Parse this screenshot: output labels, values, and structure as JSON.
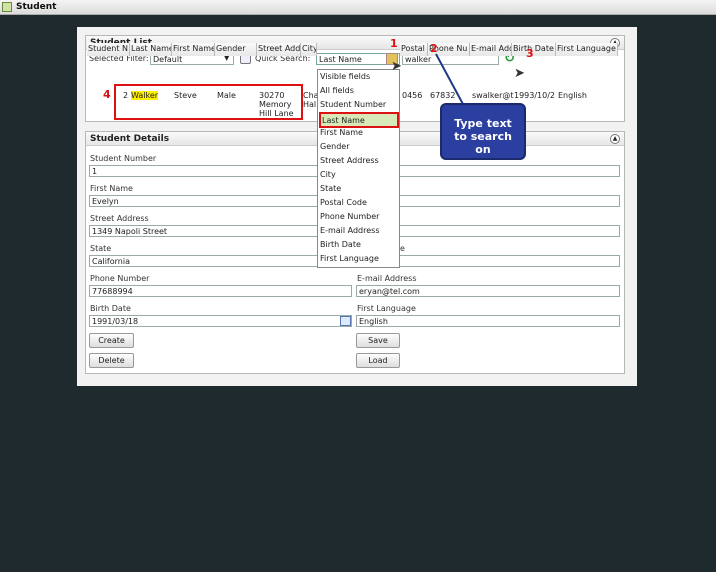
{
  "window": {
    "title": "Student"
  },
  "student_list": {
    "title": "Student List",
    "selected_filter_label": "Selected Filter:",
    "selected_filter_value": "Default",
    "quick_search_label": "Quick Search:",
    "quick_search_field": "Last Name",
    "search_value": "walker",
    "columns": [
      "Student N",
      "Last Name",
      "First Name",
      "Gender",
      "Street Addr",
      "City",
      "Postal Code",
      "Phone Nu",
      "E-mail Add",
      "Birth Date",
      "First Language"
    ],
    "row": {
      "num": "2",
      "last": "Walker",
      "first": "Steve",
      "gender": "Male",
      "street1": "30270",
      "street2": "Memory",
      "street3": "Hill Lane",
      "city": "Cha",
      "city2": "Hal",
      "postal": "0456",
      "phone": "67832",
      "email": "swalker@t",
      "birth": "1993/10/2",
      "lang": "English"
    }
  },
  "dropdown": {
    "items": [
      "Visible fields",
      "All fields",
      "Student Number",
      "Last Name",
      "First Name",
      "Gender",
      "Street Address",
      "City",
      "State",
      "Postal Code",
      "Phone Number",
      "E-mail Address",
      "Birth Date",
      "First Language"
    ]
  },
  "annotations": {
    "n1": "1",
    "n2": "2",
    "n3": "3",
    "n4": "4",
    "callout": "Type text to search on"
  },
  "student_details": {
    "title": "Student Details",
    "student_number_label": "Student Number",
    "student_number": "1",
    "first_name_label": "First Name",
    "first_name": "Evelyn",
    "street_label": "Street Address",
    "street": "1349 Napoli Street",
    "state_label": "State",
    "state": "California",
    "phone_label": "Phone Number",
    "phone": "77688994",
    "email_label": "E-mail Address",
    "email": "eryan@tel.com",
    "birth_label": "Birth Date",
    "birth": "1991/03/18",
    "lang_label": "First Language",
    "lang": "English",
    "right_partial_label": "e",
    "create": "Create",
    "delete": "Delete",
    "save": "Save",
    "load": "Load"
  }
}
